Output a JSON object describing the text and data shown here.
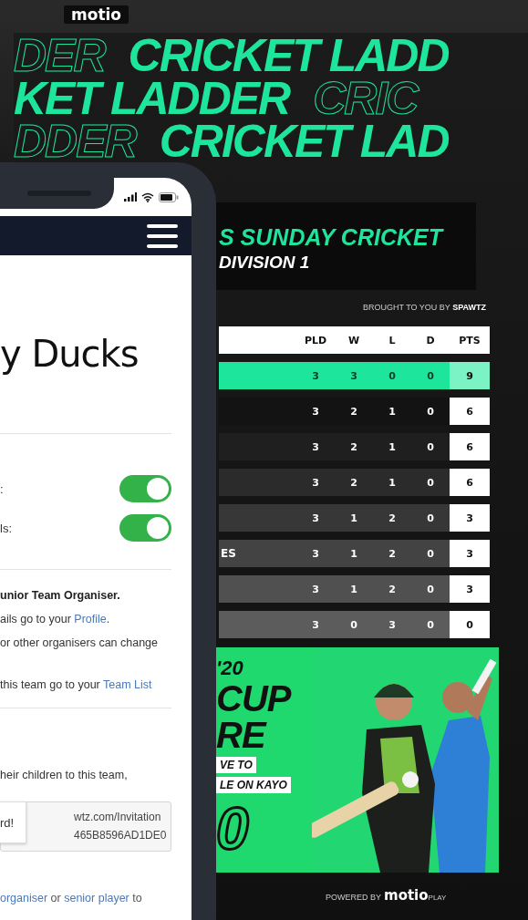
{
  "brand": "motio",
  "banner_rows": [
    {
      "parts": [
        {
          "text": "DER",
          "outline": true
        },
        {
          "text": "CRICKET LADD",
          "outline": false
        }
      ]
    },
    {
      "parts": [
        {
          "text": "KET LADDER",
          "outline": false
        },
        {
          "text": "CRIC",
          "outline": true
        }
      ]
    },
    {
      "parts": [
        {
          "text": "DDER",
          "outline": true
        },
        {
          "text": "CRICKET LAD",
          "outline": false
        }
      ]
    }
  ],
  "title_panel": {
    "title": "S SUNDAY CRICKET",
    "subtitle": "DIVISION 1"
  },
  "sponsor_line": "BROUGHT TO YOU BY **SPAWTZ**",
  "ladder": {
    "columns": [
      "PLD",
      "W",
      "L",
      "D",
      "PTS"
    ],
    "rows": [
      {
        "highlighted": true,
        "pld": "3",
        "w": "3",
        "l": "0",
        "d": "0",
        "pts": "9"
      },
      {
        "highlighted": false,
        "pld": "3",
        "w": "2",
        "l": "1",
        "d": "0",
        "pts": "6"
      },
      {
        "highlighted": false,
        "pld": "3",
        "w": "2",
        "l": "1",
        "d": "0",
        "pts": "6"
      },
      {
        "highlighted": false,
        "pld": "3",
        "w": "2",
        "l": "1",
        "d": "0",
        "pts": "6"
      },
      {
        "highlighted": false,
        "pld": "3",
        "w": "1",
        "l": "2",
        "d": "0",
        "pts": "3"
      },
      {
        "highlighted": false,
        "team": "ES",
        "pld": "3",
        "w": "1",
        "l": "2",
        "d": "0",
        "pts": "3"
      },
      {
        "highlighted": false,
        "pld": "3",
        "w": "1",
        "l": "2",
        "d": "0",
        "pts": "3"
      },
      {
        "highlighted": false,
        "pld": "3",
        "w": "0",
        "l": "3",
        "d": "0",
        "pts": "0"
      }
    ]
  },
  "ad": {
    "lines": [
      {
        "kind": "small",
        "text": "'20"
      },
      {
        "kind": "big",
        "text": "CUP"
      },
      {
        "kind": "big",
        "text": "RE"
      },
      {
        "kind": "tag",
        "text": "VE TO"
      },
      {
        "kind": "tag",
        "text": "LE ON KAYO"
      },
      {
        "kind": "outline",
        "text": "0"
      }
    ],
    "kind": "picture"
  },
  "footer": {
    "prefix": "POWERED BY",
    "brand": "motio",
    "suffix": "PLAY"
  },
  "phone": {
    "heading": "y Ducks",
    "toggles": [
      {
        "label": ":",
        "on": true
      },
      {
        "label": "ls:",
        "on": true
      }
    ],
    "info_lines": [
      [
        {
          "kind": "bold",
          "text": "unior Team Organiser."
        }
      ],
      [
        {
          "kind": "text",
          "text": "ails go to your "
        },
        {
          "kind": "link",
          "text": "Profile"
        },
        {
          "kind": "text",
          "text": "."
        }
      ],
      [
        {
          "kind": "text",
          "text": "or other organisers can change"
        }
      ],
      [
        {
          "kind": "text",
          "text": "this team go to your "
        },
        {
          "kind": "link",
          "text": "Team List"
        }
      ]
    ],
    "invite_text": "heir children to this team,",
    "invite_field": {
      "value_lines": [
        "wtz.com/Invitation",
        "465B8596AD1DE0"
      ]
    },
    "tooltip": "rd!",
    "bottom_line": [
      {
        "kind": "link",
        "text": "organiser"
      },
      {
        "kind": "text",
        "text": " or "
      },
      {
        "kind": "link",
        "text": "senior player"
      },
      {
        "kind": "text",
        "text": " to"
      }
    ]
  }
}
